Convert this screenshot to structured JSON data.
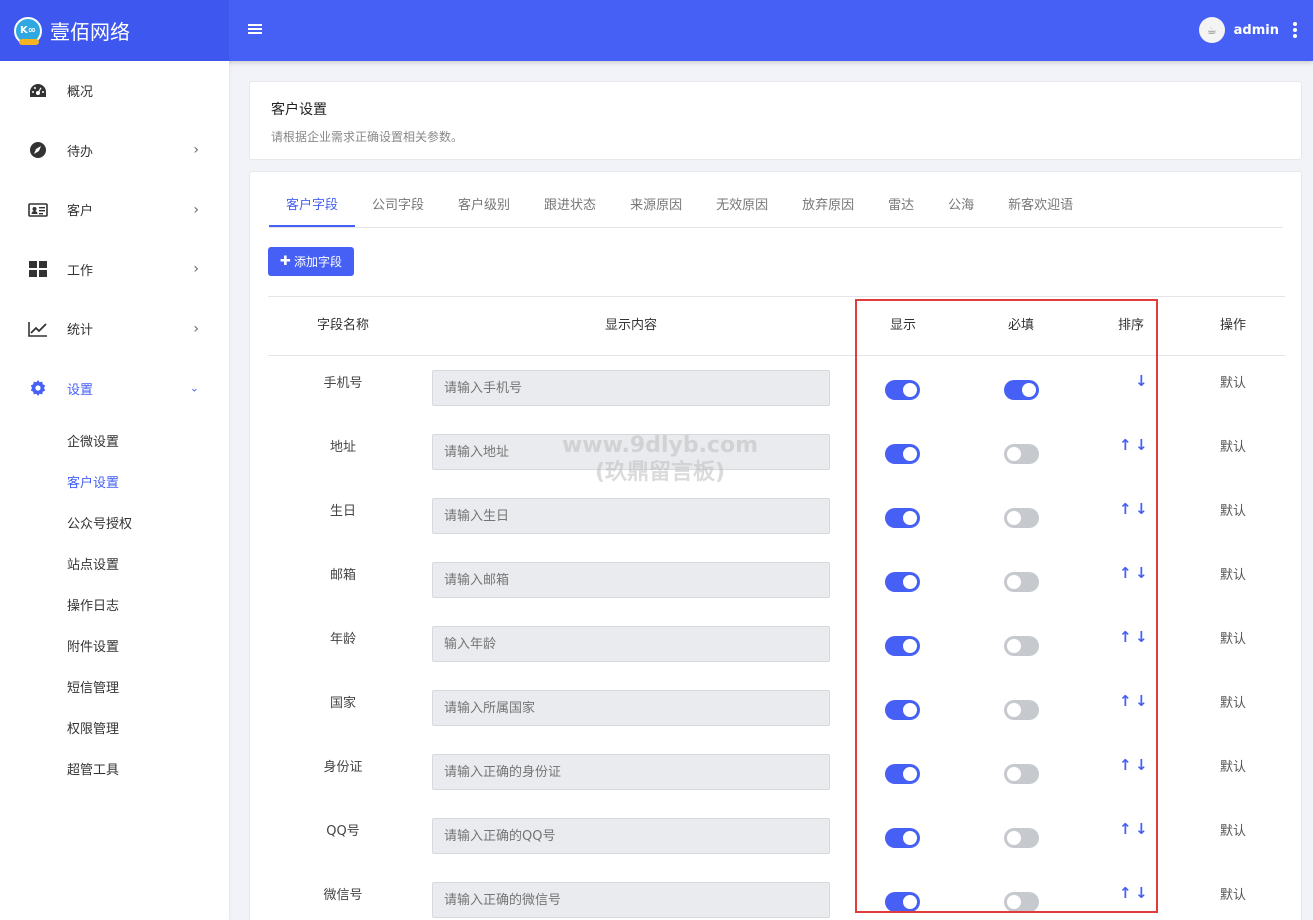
{
  "header": {
    "brand": "壹佰网络",
    "logo_text": "K∞",
    "username": "admin"
  },
  "sidebar": {
    "items": [
      {
        "label": "概况",
        "icon": "dashboard-icon"
      },
      {
        "label": "待办",
        "icon": "compass-icon"
      },
      {
        "label": "客户",
        "icon": "id-card-icon"
      },
      {
        "label": "工作",
        "icon": "grid-icon"
      },
      {
        "label": "统计",
        "icon": "chart-line-icon"
      },
      {
        "label": "设置",
        "icon": "gear-icon"
      }
    ],
    "sub_items": [
      "企微设置",
      "客户设置",
      "公众号授权",
      "站点设置",
      "操作日志",
      "附件设置",
      "短信管理",
      "权限管理",
      "超管工具"
    ]
  },
  "page": {
    "title": "客户设置",
    "description": "请根据企业需求正确设置相关参数。"
  },
  "tabs": [
    "客户字段",
    "公司字段",
    "客户级别",
    "跟进状态",
    "来源原因",
    "无效原因",
    "放弃原因",
    "雷达",
    "公海",
    "新客欢迎语"
  ],
  "add_button": "添加字段",
  "table": {
    "headers": {
      "name": "字段名称",
      "content": "显示内容",
      "show": "显示",
      "required": "必填",
      "sort": "排序",
      "action": "操作"
    },
    "rows": [
      {
        "name": "手机号",
        "placeholder": "请输入手机号",
        "show": true,
        "required": true,
        "up": false,
        "down": true,
        "action": "默认"
      },
      {
        "name": "地址",
        "placeholder": "请输入地址",
        "show": true,
        "required": false,
        "up": true,
        "down": true,
        "action": "默认"
      },
      {
        "name": "生日",
        "placeholder": "请输入生日",
        "show": true,
        "required": false,
        "up": true,
        "down": true,
        "action": "默认"
      },
      {
        "name": "邮箱",
        "placeholder": "请输入邮箱",
        "show": true,
        "required": false,
        "up": true,
        "down": true,
        "action": "默认"
      },
      {
        "name": "年龄",
        "placeholder": "输入年龄",
        "show": true,
        "required": false,
        "up": true,
        "down": true,
        "action": "默认"
      },
      {
        "name": "国家",
        "placeholder": "请输入所属国家",
        "show": true,
        "required": false,
        "up": true,
        "down": true,
        "action": "默认"
      },
      {
        "name": "身份证",
        "placeholder": "请输入正确的身份证",
        "show": true,
        "required": false,
        "up": true,
        "down": true,
        "action": "默认"
      },
      {
        "name": "QQ号",
        "placeholder": "请输入正确的QQ号",
        "show": true,
        "required": false,
        "up": true,
        "down": true,
        "action": "默认"
      },
      {
        "name": "微信号",
        "placeholder": "请输入正确的微信号",
        "show": true,
        "required": false,
        "up": true,
        "down": true,
        "action": "默认"
      }
    ]
  },
  "watermark": {
    "line1": "www.9dlyb.com",
    "line2": "(玖鼎留言板)"
  },
  "colors": {
    "primary": "#4660f5",
    "highlight": "#e23b3b",
    "toggle_off": "#c6c9ce"
  }
}
